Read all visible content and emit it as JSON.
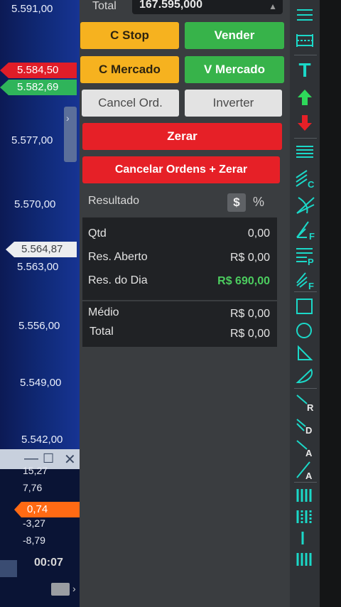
{
  "axis": {
    "prices": [
      "5.591,00",
      "5.577,00",
      "5.570,00",
      "5.563,00",
      "5.556,00",
      "5.549,00",
      "5.542,00"
    ],
    "sell_tag": "5.584,50",
    "buy_tag": "5.582,69",
    "last_tag": "5.564,87"
  },
  "subwindow": {
    "values": [
      "15,27",
      "7,76",
      "-3,27",
      "-8,79"
    ],
    "current_tag": "0,74",
    "timer": "00:07",
    "minimize": "—",
    "maximize": "☐",
    "close": "✕"
  },
  "total": {
    "label": "Total",
    "value": "167.595,000"
  },
  "buttons": {
    "c_stop": "C Stop",
    "vender": "Vender",
    "c_mercado": "C Mercado",
    "v_mercado": "V Mercado",
    "cancel_ord": "Cancel Ord.",
    "inverter": "Inverter",
    "zerar": "Zerar",
    "cancelar_zerar": "Cancelar Ordens + Zerar"
  },
  "result": {
    "header": "Resultado",
    "currency_toggle": "$",
    "percent_toggle": "%",
    "rows": [
      {
        "label": "Qtd",
        "value": "0,00"
      },
      {
        "label": "Res. Aberto",
        "value": "R$ 0,00"
      },
      {
        "label": "Res. do Dia",
        "value": "R$ 690,00"
      },
      {
        "label": "Médio",
        "value": "R$ 0,00"
      },
      {
        "label": "Total",
        "value": "R$ 0,00"
      }
    ]
  },
  "colors": {
    "sell": "#e01d28",
    "buy": "#2fb45a",
    "accent": "#1bd8c8",
    "warning": "#f6b21f",
    "profit": "#4ccd5f"
  },
  "toolbar": {
    "icons": [
      "horizontal-lines-icon",
      "horizontal-range-icon",
      "text-icon",
      "arrow-up-icon",
      "arrow-down-icon",
      "multi-line-icon",
      "channel-icon",
      "fan-icon",
      "fibonacci-icon",
      "fibonacci-projection-icon",
      "fibonacci-fan-icon",
      "rectangle-icon",
      "circle-icon",
      "triangle-icon",
      "arc-icon",
      "ray-icon",
      "double-ray-icon",
      "angle-line-icon",
      "trend-line-icon",
      "bars-icon",
      "dash-bars-icon",
      "single-bar-icon",
      "histogram-icon"
    ],
    "labels": {
      "channel": "C",
      "fib": "F",
      "fib_proj": "P",
      "fib_fan": "F",
      "ray": "R",
      "double_ray": "D",
      "angle": "A",
      "trend": "A"
    }
  }
}
